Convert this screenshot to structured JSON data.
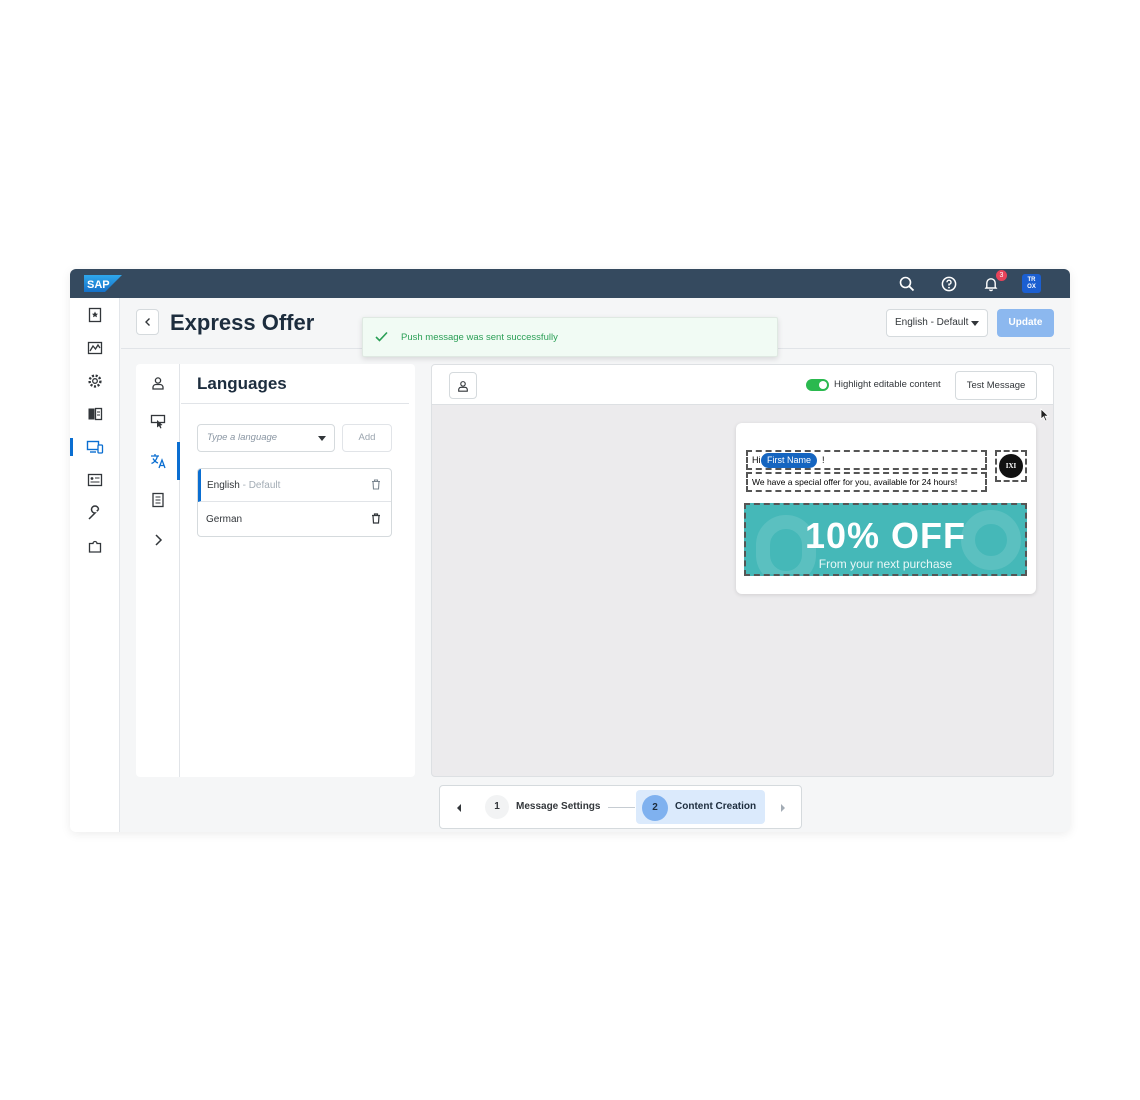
{
  "shell": {
    "logo_text": "SAP",
    "notification_count": "3",
    "avatar_initials_line1": "TR",
    "avatar_initials_line2": "OX",
    "icons": [
      "search-icon",
      "help-icon",
      "bell-icon"
    ]
  },
  "nav": {
    "items": [
      "bookmark-icon",
      "analytics-icon",
      "settings-icon",
      "comparison-icon",
      "devices-icon",
      "contact-card-icon",
      "wrench-icon",
      "puzzle-icon"
    ],
    "active_index": 4
  },
  "header": {
    "title": "Express Offer",
    "language_select": "English - Default",
    "update_label": "Update"
  },
  "toast": {
    "message": "Push message was sent successfully"
  },
  "panel": {
    "tabs": [
      "user-icon",
      "touch-icon",
      "translate-icon",
      "document-icon",
      "chevron-right-icon"
    ],
    "active_tab_index": 2,
    "title": "Languages",
    "input_placeholder": "Type a language",
    "add_label": "Add",
    "languages": [
      {
        "name": "English",
        "suffix": " - Default"
      },
      {
        "name": "German",
        "suffix": ""
      }
    ]
  },
  "preview": {
    "highlight_label": "Highlight editable content",
    "highlight_on": true,
    "test_label": "Test Message",
    "message": {
      "greeting": "Hi",
      "first_name_chip": "First Name",
      "exclamation": "!",
      "offer_line": "We have a special offer for you, available for 24 hours!",
      "logo_text": "IXI",
      "banner_headline": "10% OFF",
      "banner_sub": "From your next purchase"
    }
  },
  "stepper": {
    "steps": [
      {
        "number": "1",
        "label": "Message Settings"
      },
      {
        "number": "2",
        "label": "Content Creation"
      }
    ],
    "active_step": 2
  },
  "colors": {
    "shell": "#354a5f",
    "accent": "#0a6ed1",
    "success": "#2ab94f",
    "banner": "#45b8b8",
    "update_button": "#8cb8ef"
  }
}
